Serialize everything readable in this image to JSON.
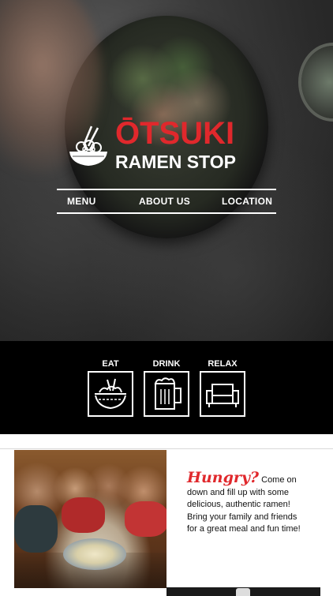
{
  "brand": {
    "name_main": "ŌTSUKI",
    "name_sub": "RAMEN STOP",
    "accent_color": "#e0282c",
    "logo_icon": "ramen-bowl-chopsticks-icon"
  },
  "nav": {
    "items": [
      {
        "label": "MENU"
      },
      {
        "label": "ABOUT US"
      },
      {
        "label": "LOCATION"
      }
    ]
  },
  "features": [
    {
      "label": "EAT",
      "icon": "rice-bowl-icon"
    },
    {
      "label": "DRINK",
      "icon": "beer-mug-icon"
    },
    {
      "label": "RELAX",
      "icon": "armchair-icon"
    }
  ],
  "about": {
    "heading": "Hungry?",
    "body": " Come on down and fill up with some delicious, authentic ramen! Bring your family and friends for a great meal and fun time!"
  }
}
